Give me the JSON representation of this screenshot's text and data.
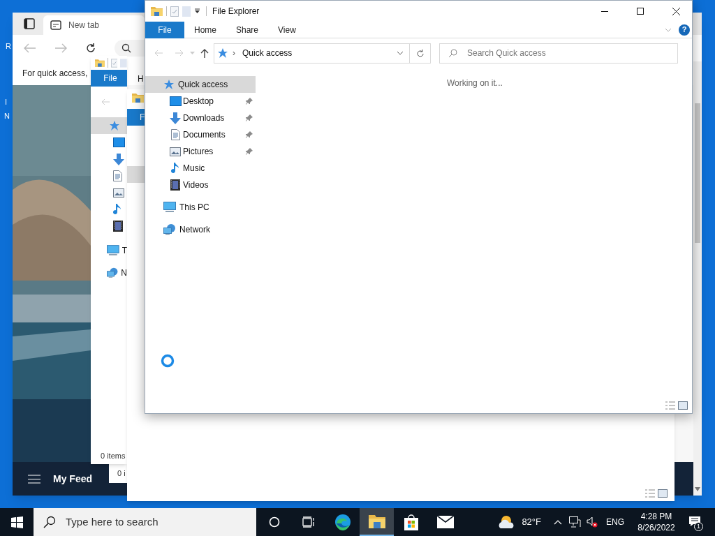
{
  "desktop_icon_labels": [
    "R",
    "I",
    "N"
  ],
  "browser": {
    "tab_title": "New tab",
    "infobar_text": "For quick access,",
    "feed_title": "My Feed"
  },
  "back_windows": [
    {
      "ribbon_tabs": [
        "File",
        "H"
      ],
      "nav_labels": [
        "T",
        "N"
      ],
      "status": "0 items"
    },
    {
      "ribbon_tabs": [
        "F"
      ],
      "status": "0 i"
    }
  ],
  "window": {
    "title": "File Explorer",
    "ribbon_tabs": [
      {
        "label": "File",
        "selected": true
      },
      {
        "label": "Home",
        "selected": false
      },
      {
        "label": "Share",
        "selected": false
      },
      {
        "label": "View",
        "selected": false
      }
    ],
    "help_glyph": "?",
    "address": {
      "separator": "›",
      "location": "Quick access"
    },
    "search": {
      "placeholder": "Search Quick access"
    },
    "nav": [
      {
        "label": "Quick access",
        "selected": true,
        "children": [
          {
            "label": "Desktop",
            "pinned": true
          },
          {
            "label": "Downloads",
            "pinned": true
          },
          {
            "label": "Documents",
            "pinned": true
          },
          {
            "label": "Pictures",
            "pinned": true
          },
          {
            "label": "Music",
            "pinned": false
          },
          {
            "label": "Videos",
            "pinned": false
          }
        ]
      },
      {
        "label": "This PC",
        "selected": false
      },
      {
        "label": "Network",
        "selected": false
      }
    ],
    "status_text": "Working on it..."
  },
  "taskbar": {
    "search_placeholder": "Type here to search",
    "apps": [
      {
        "selected": false
      },
      {
        "selected": false
      },
      {
        "selected": false
      },
      {
        "selected": true
      },
      {
        "selected": false
      },
      {
        "selected": false
      }
    ],
    "weather": "82°F",
    "language": "ENG",
    "time": "4:28 PM",
    "date": "8/26/2022",
    "notification_count": "1"
  }
}
